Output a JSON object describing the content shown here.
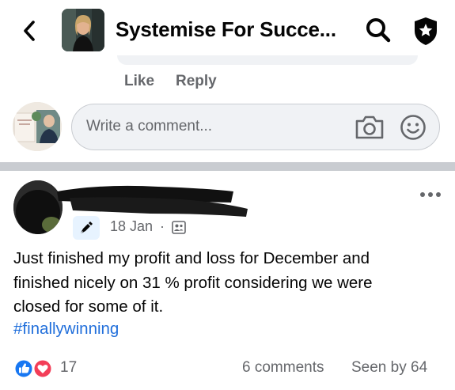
{
  "header": {
    "title": "Systemise For Succe...",
    "back_icon": "chevron-left-icon",
    "search_icon": "search-icon",
    "shield_icon": "shield-star-icon"
  },
  "previous_comment": {
    "like_label": "Like",
    "reply_label": "Reply"
  },
  "composer": {
    "placeholder": "Write a comment...",
    "camera_icon": "camera-icon",
    "emoji_icon": "emoji-icon"
  },
  "post": {
    "date": "18 Jan",
    "separator": "·",
    "text_lines": [
      "Just finished my profit and loss for December and",
      "finished nicely on 31 % profit  considering we were",
      "closed for some of it."
    ],
    "hashtag": "#finallywinning",
    "reaction_count": "17",
    "comments_count": "6 comments",
    "seen_by": "Seen by 64"
  },
  "colors": {
    "link_blue": "#216fdb",
    "secondary_text": "#65676b",
    "divider": "#c9ccd1",
    "like_blue": "#1877f2",
    "love_red": "#f33e58"
  }
}
